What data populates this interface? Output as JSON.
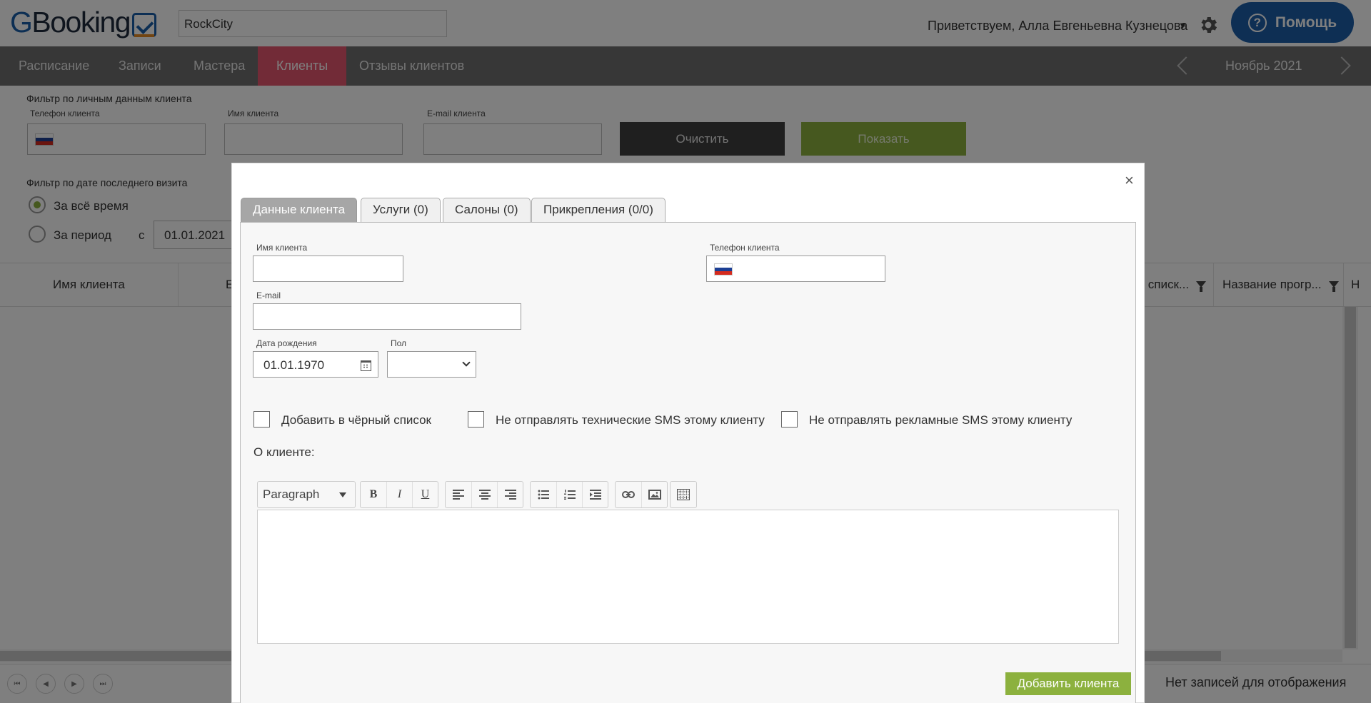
{
  "header": {
    "logo_prefix": "G",
    "logo_rest": "Booking",
    "search_value": "RockCity",
    "greeting": "Приветствуем, Алла Евгеньевна Кузнецова",
    "greeting_caret": "▼",
    "help_label": "Помощь"
  },
  "nav": {
    "tabs": [
      {
        "label": "Расписание"
      },
      {
        "label": "Записи"
      },
      {
        "label": "Мастера"
      },
      {
        "label": "Клиенты"
      },
      {
        "label": "Отзывы клиентов"
      }
    ],
    "active_tab": "Клиенты",
    "month": "Ноябрь 2021"
  },
  "filter": {
    "section_title": "Фильтр по личным данным клиента",
    "phone_label": "Телефон клиента",
    "name_label": "Имя клиента",
    "email_label": "E-mail клиента",
    "clear_label": "Очистить",
    "show_label": "Показать",
    "date_title": "Фильтр по дате последнего визита",
    "all_time_label": "За всё время",
    "period_label": "За период",
    "from_label": "с",
    "from_date": "01.01.2021"
  },
  "grid": {
    "columns": [
      "Имя клиента",
      "Е",
      "в списк...",
      "Название прогр...",
      "Н"
    ],
    "empty_text": "Нет записей для отображения"
  },
  "pager": {
    "first": "⏮",
    "prev": "◀",
    "next": "▶",
    "last": "⏭"
  },
  "modal": {
    "close": "×",
    "tabs": [
      {
        "label": "Данные клиента"
      },
      {
        "label": "Услуги (0)"
      },
      {
        "label": "Салоны (0)"
      },
      {
        "label": "Прикрепления (0/0)"
      }
    ],
    "name_label": "Имя клиента",
    "phone_label": "Телефон клиента",
    "email_label": "E-mail",
    "birth_label": "Дата рождения",
    "birth_value": "01.01.1970",
    "gender_label": "Пол",
    "blacklist_label": "Добавить в чёрный список",
    "no_tech_sms_label": "Не отправлять технические SMS этому клиенту",
    "no_ad_sms_label": "Не отправлять рекламные SMS этому клиенту",
    "about_label": "О клиенте:",
    "editor": {
      "format": "Paragraph",
      "bold": "B",
      "italic": "I",
      "underline": "U"
    },
    "add_button": "Добавить клиента"
  },
  "colors": {
    "brand_blue": "#1d5fa9",
    "active_tab": "#e5576e",
    "green": "#8cb13e",
    "dark_button": "#3f3f3f"
  }
}
